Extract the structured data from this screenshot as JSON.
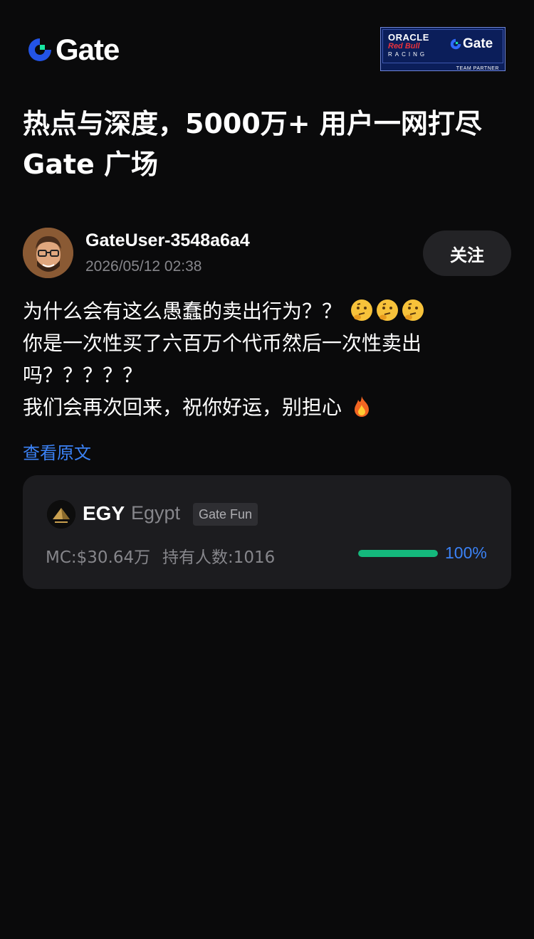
{
  "header": {
    "brand_name": "Gate",
    "partner_badge": {
      "line1": "ORACLE",
      "line2": "Red Bull",
      "line3": "RACING",
      "gate_text": "Gate",
      "footer": "TEAM PARTNER"
    }
  },
  "headline": {
    "line1": "热点与深度，5000万+ 用户一网打尽",
    "line2": "Gate 广场"
  },
  "post": {
    "author": {
      "username": "GateUser-3548a6a4",
      "timestamp": "2026/05/12 02:38",
      "follow_label": "关注"
    },
    "lines": [
      "为什么会有这么愚蠢的卖出行为？？ ",
      "你是一次性买了六百万个代币然后一次性卖出",
      "吗？？？？？",
      "我们会再次回来，祝你好运，别担心 "
    ],
    "view_original_label": "查看原文"
  },
  "token_card": {
    "symbol": "EGY",
    "name": "Egypt",
    "badge": "Gate Fun",
    "market_cap": "MC:$30.64万",
    "holders": "持有人数:1016",
    "progress_label": "100%",
    "progress_value": 1.0
  },
  "colors": {
    "background": "#0a0a0b",
    "card": "#1c1c1f",
    "link": "#3b82f6",
    "progress": "#14b87c",
    "brand_blue": "#2354e6",
    "brand_green": "#17e6a1"
  }
}
